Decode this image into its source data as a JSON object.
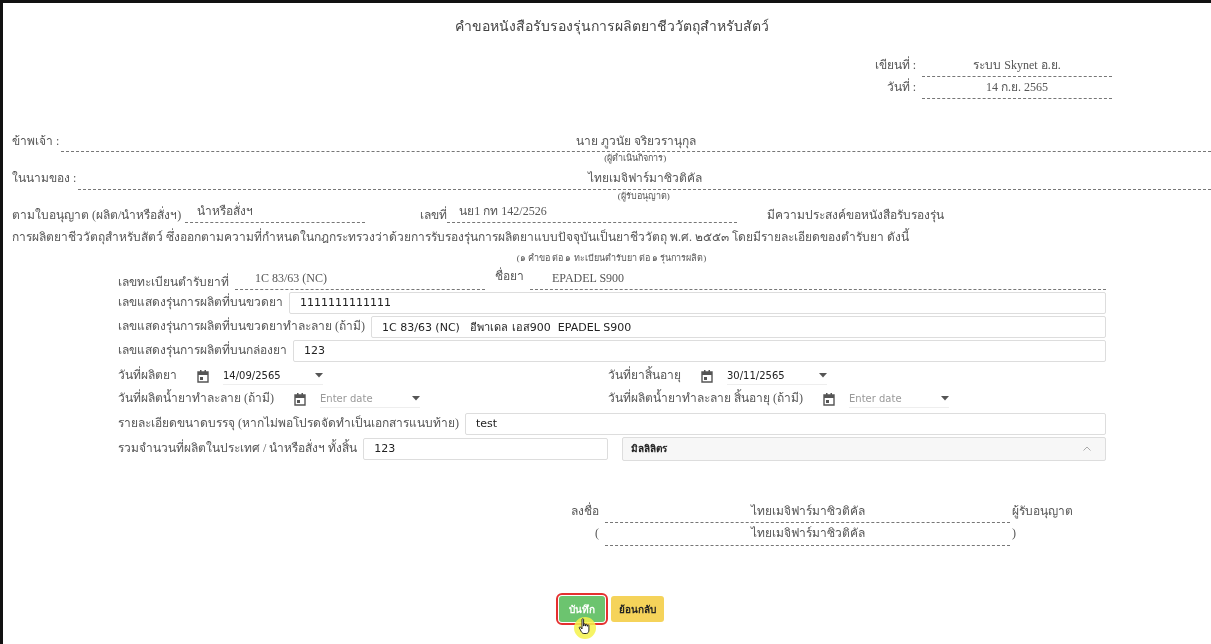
{
  "title": "คำขอหนังสือรับรองรุ่นการผลิตยาชีววัตถุสำหรับสัตว์",
  "meta": [
    {
      "label": "เขียนที่ :",
      "value": "ระบบ Skynet อ.ย."
    },
    {
      "label": "วันที่ :",
      "value": "14 ก.ย. 2565"
    }
  ],
  "parties": [
    {
      "label": "ข้าพเจ้า :",
      "value": "นาย ภูวนัย จริยวรานุกุล",
      "caption": "(ผู้ดำเนินกิจการ)"
    },
    {
      "label": "ในนามของ :",
      "value": "ไทยเมจิฟาร์มาซิวติคัล",
      "caption": "(ผู้รับอนุญาต)"
    }
  ],
  "license": {
    "label": "ตามใบอนุญาต (ผลิต/นำหรือสั่งฯ)",
    "type": "นำหรือสั่งฯ",
    "number_label": "เลขที่",
    "number": "นย1 กท 142/2526",
    "trailing": "มีความประสงค์ขอหนังสือรับรองรุ่น"
  },
  "statement": "การผลิตยาชีววัตถุสำหรับสัตว์ ซึ่งออกตามความที่กำหนดในกฎกระทรวงว่าด้วยการรับรองรุ่นการผลิตยาแบบปัจจุบันเป็นยาชีววัตถุ พ.ศ. ๒๕๕๓ โดยมีรายละเอียดของตำรับยา ดังนี้",
  "note": "(๑ คำขอ ต่อ ๑ ทะเบียนตำรับยา ต่อ ๑ รุ่นการผลิต)",
  "registration": {
    "label": "เลขทะเบียนตำรับยาที่",
    "value": "1C 83/63 (NC)",
    "name_label": "ชื่อยา",
    "name": "EPADEL S900"
  },
  "fields": [
    {
      "label": "เลขแสดงรุ่นการผลิตที่บนขวดยา",
      "value": "1111111111111"
    },
    {
      "label": "เลขแสดงรุ่นการผลิตที่บนขวดยาทำละลาย (ถ้ามี)",
      "value": "1C 83/63 (NC)   อีพาเดล เอส900  EPADEL S900"
    },
    {
      "label": "เลขแสดงรุ่นการผลิตที่บนกล่องยา",
      "value": "123"
    }
  ],
  "date_rows": [
    {
      "left": {
        "label": "วันที่ผลิตยา",
        "value": "14/09/2565"
      },
      "right": {
        "label": "วันที่ยาสิ้นอายุ",
        "value": "30/11/2565"
      }
    },
    {
      "left": {
        "label": "วันที่ผลิตน้ำยาทำละลาย (ถ้ามี)",
        "placeholder": "Enter date"
      },
      "right": {
        "label": "วันที่ผลิตน้ำยาทำละลาย สิ้นอายุ (ถ้ามี)",
        "placeholder": "Enter date"
      }
    }
  ],
  "package": {
    "label": "รายละเอียดขนาดบรรจุ (หากไม่พอโปรดจัดทำเป็นเอกสารแนบท้าย)",
    "value": "test"
  },
  "total": {
    "label": "รวมจำนวนที่ผลิตในประเทศ / นำหรือสั่งฯ ทั้งสิ้น",
    "value": "123",
    "unit": "มิลลิลิตร"
  },
  "signature": {
    "label": "ลงชื่อ",
    "name": "ไทยเมจิฟาร์มาซิวติคัล",
    "role": "ผู้รับอนุญาต",
    "open": "(",
    "printed_name": "ไทยเมจิฟาร์มาซิวติคัล",
    "close": ")"
  },
  "buttons": [
    {
      "label": "บันทึก",
      "kind": "save",
      "highlighted": true
    },
    {
      "label": "ย้อนกลับ",
      "kind": "back",
      "highlighted": false
    }
  ]
}
